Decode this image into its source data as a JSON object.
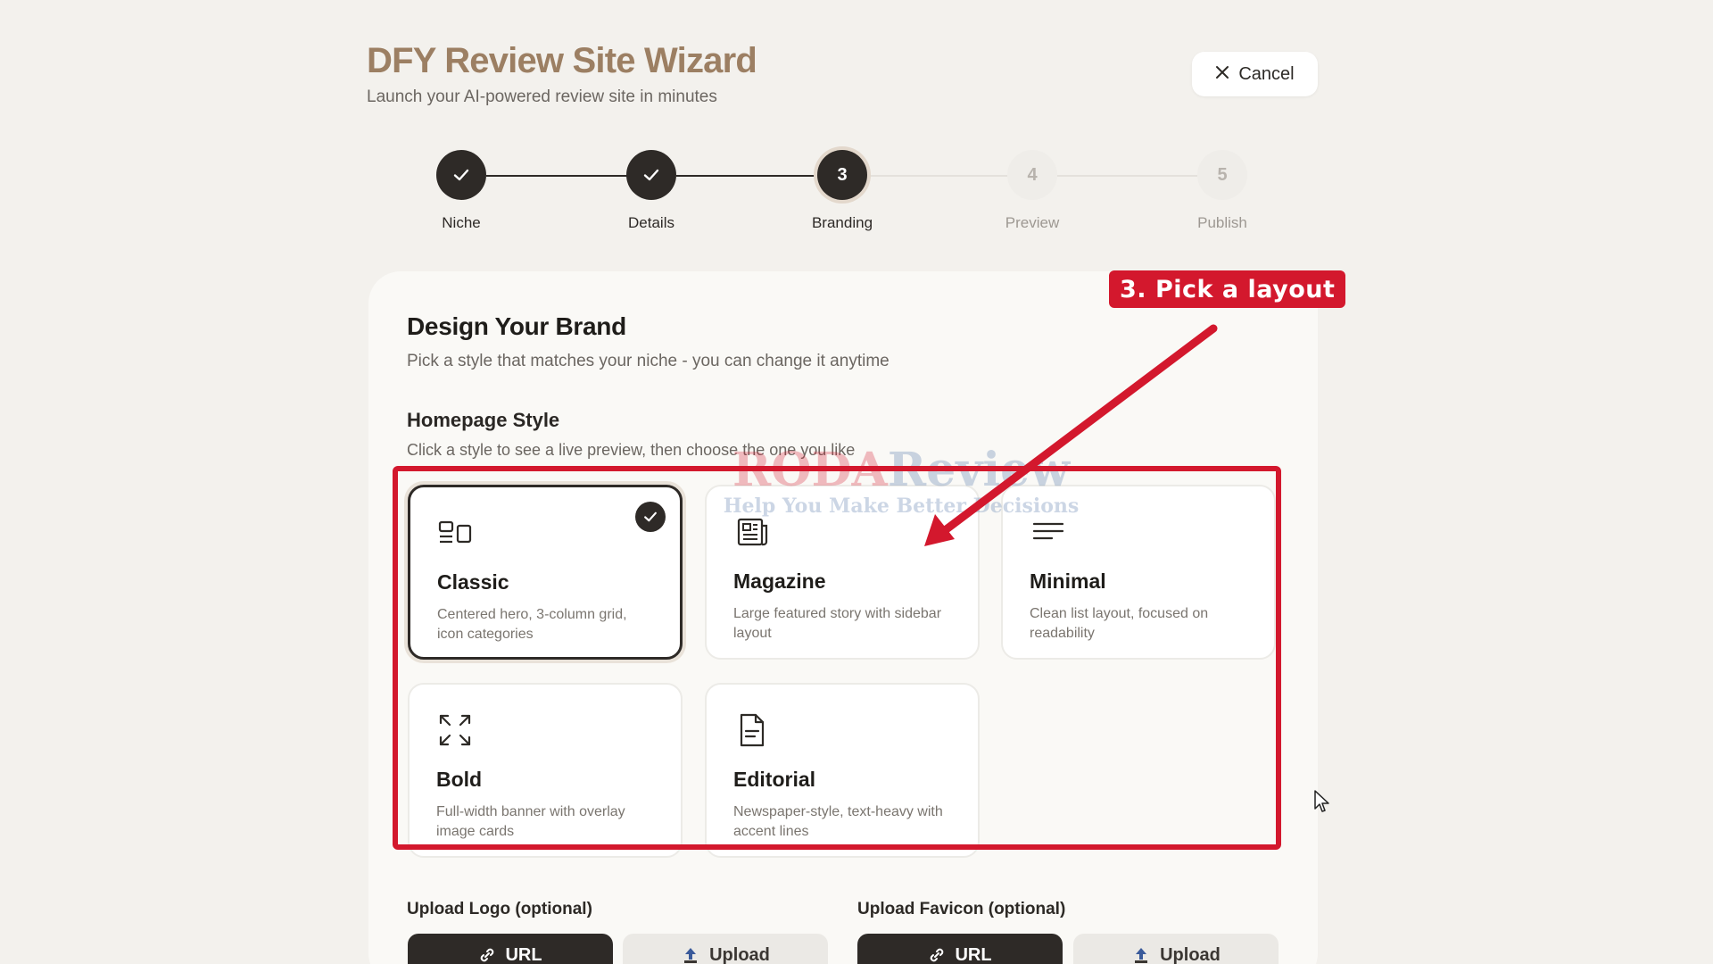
{
  "header": {
    "title": "DFY Review Site Wizard",
    "subtitle": "Launch your AI-powered review site in minutes",
    "cancel_label": "Cancel"
  },
  "steps": [
    {
      "number": "1",
      "label": "Niche",
      "status": "done"
    },
    {
      "number": "2",
      "label": "Details",
      "status": "done"
    },
    {
      "number": "3",
      "label": "Branding",
      "status": "active"
    },
    {
      "number": "4",
      "label": "Preview",
      "status": "todo"
    },
    {
      "number": "5",
      "label": "Publish",
      "status": "todo"
    }
  ],
  "brand": {
    "title": "Design Your Brand",
    "subtitle": "Pick a style that matches your niche - you can change it anytime"
  },
  "homepage_style": {
    "title": "Homepage Style",
    "subtitle": "Click a style to see a live preview, then choose the one you like",
    "selected": "Classic",
    "options": [
      {
        "name": "Classic",
        "desc": "Centered hero, 3-column grid, icon categories",
        "icon": "classic-layout-icon"
      },
      {
        "name": "Magazine",
        "desc": "Large featured story with sidebar layout",
        "icon": "newspaper-icon"
      },
      {
        "name": "Minimal",
        "desc": "Clean list layout, focused on readability",
        "icon": "text-lines-icon"
      },
      {
        "name": "Bold",
        "desc": "Full-width banner with overlay image cards",
        "icon": "expand-icon"
      },
      {
        "name": "Editorial",
        "desc": "Newspaper-style, text-heavy with accent lines",
        "icon": "document-icon"
      }
    ]
  },
  "annotation": {
    "callout": "3. Pick a layout",
    "color": "#d3182d"
  },
  "watermark": {
    "main_a": "RODA",
    "main_b": "Review",
    "sub": "Help You Make Better Decisions"
  },
  "uploads": {
    "logo_label": "Upload Logo (optional)",
    "favicon_label": "Upload Favicon (optional)",
    "url_label": "URL",
    "upload_label": "Upload"
  },
  "colors": {
    "accent_dark": "#2e2a27",
    "title_brown": "#9c7f63",
    "background": "#f3f1ed"
  }
}
